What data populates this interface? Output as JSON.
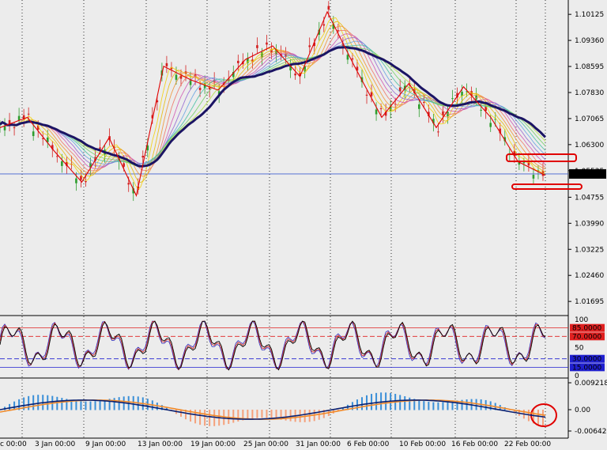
{
  "chart_data": [
    {
      "type": "candlestick",
      "panel": "price",
      "y_ticks": [
        "1.10125",
        "1.09360",
        "1.08595",
        "1.07830",
        "1.07065",
        "1.06300",
        "1.05535",
        "1.04755",
        "1.03990",
        "1.03225",
        "1.02460",
        "1.01695"
      ],
      "current_price": "1.05439",
      "x_ticks": [
        "c 00:00",
        "3 Jan 00:00",
        "9 Jan 00:00",
        "13 Jan 00:00",
        "19 Jan 00:00",
        "25 Jan 00:00",
        "31 Jan 00:00",
        "6 Feb 00:00",
        "10 Feb 00:00",
        "16 Feb 00:00",
        "22 Feb 00:00"
      ],
      "zigzag_close_estimates": [
        1.068,
        1.071,
        1.061,
        1.052,
        1.065,
        1.048,
        1.086,
        1.082,
        1.079,
        1.088,
        1.092,
        1.083,
        1.102,
        1.086,
        1.071,
        1.081,
        1.068,
        1.08,
        1.071,
        1.058,
        1.054
      ],
      "colors": {
        "ma_slow": "#1b1464",
        "zigzag": "#e00000",
        "bull": "#2e9e2e",
        "bear": "#d42020",
        "current_line": "#4060d0"
      }
    },
    {
      "type": "line",
      "panel": "stochastic",
      "levels": [
        "85.0000",
        "70.0000",
        "30.0000",
        "15.0000"
      ],
      "y_ticks": [
        "100",
        "50",
        "0"
      ],
      "colors": {
        "main": "#000000",
        "signal": "#d02020",
        "signal2": "#3030c0"
      }
    },
    {
      "type": "histogram",
      "panel": "macd",
      "y_ticks": [
        "0.0092189",
        "0.00",
        "-0.006425"
      ],
      "colors": {
        "positive": "#3a8fd8",
        "negative": "#f5a07a",
        "macd": "#0a2070",
        "signal": "#f08a2a"
      }
    }
  ],
  "annotations": {
    "highlight_color": "#e00000"
  }
}
